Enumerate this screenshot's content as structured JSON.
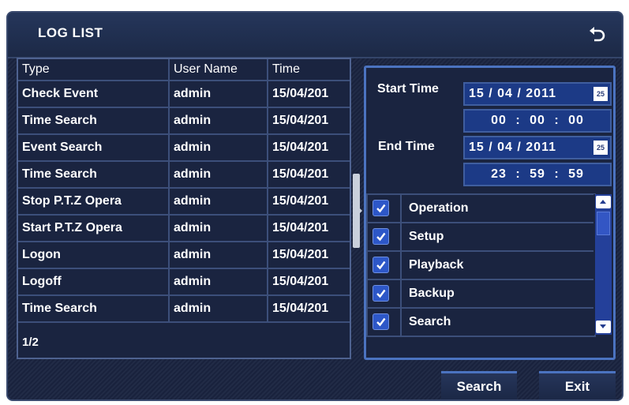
{
  "window": {
    "title": "LOG LIST"
  },
  "log_table": {
    "columns": [
      "Type",
      "User Name",
      "Time"
    ],
    "rows": [
      {
        "type": "Check Event",
        "user": "admin",
        "time": "15/04/201"
      },
      {
        "type": "Time Search",
        "user": "admin",
        "time": "15/04/201"
      },
      {
        "type": "Event Search",
        "user": "admin",
        "time": "15/04/201"
      },
      {
        "type": "Time Search",
        "user": "admin",
        "time": "15/04/201"
      },
      {
        "type": "Stop P.T.Z Opera",
        "user": "admin",
        "time": "15/04/201"
      },
      {
        "type": "Start P.T.Z Opera",
        "user": "admin",
        "time": "15/04/201"
      },
      {
        "type": "Logon",
        "user": "admin",
        "time": "15/04/201"
      },
      {
        "type": "Logoff",
        "user": "admin",
        "time": "15/04/201"
      },
      {
        "type": "Time Search",
        "user": "admin",
        "time": "15/04/201"
      }
    ],
    "page": "1/2"
  },
  "filter": {
    "start_label": "Start Time",
    "start_date": "15 / 04 / 2011",
    "start_time": "00 : 00 : 00",
    "end_label": "End Time",
    "end_date": "15 / 04 / 2011",
    "end_time": "23 : 59 : 59",
    "calendar_icon_text": "25",
    "types": [
      {
        "label": "Operation",
        "checked": true
      },
      {
        "label": "Setup",
        "checked": true
      },
      {
        "label": "Playback",
        "checked": true
      },
      {
        "label": "Backup",
        "checked": true
      },
      {
        "label": "Search",
        "checked": true
      }
    ]
  },
  "buttons": {
    "search": "Search",
    "exit": "Exit"
  },
  "icons": {
    "back": "back-arrow-icon",
    "calendar": "calendar-icon",
    "check": "checkmark-icon",
    "scroll_up": "scroll-up-icon",
    "scroll_down": "scroll-down-icon"
  },
  "colors": {
    "background": "#1a2440",
    "field": "#1c3a86",
    "accent_border": "#4b73c0",
    "checkbox": "#2d57c8",
    "text": "#ffffff"
  }
}
